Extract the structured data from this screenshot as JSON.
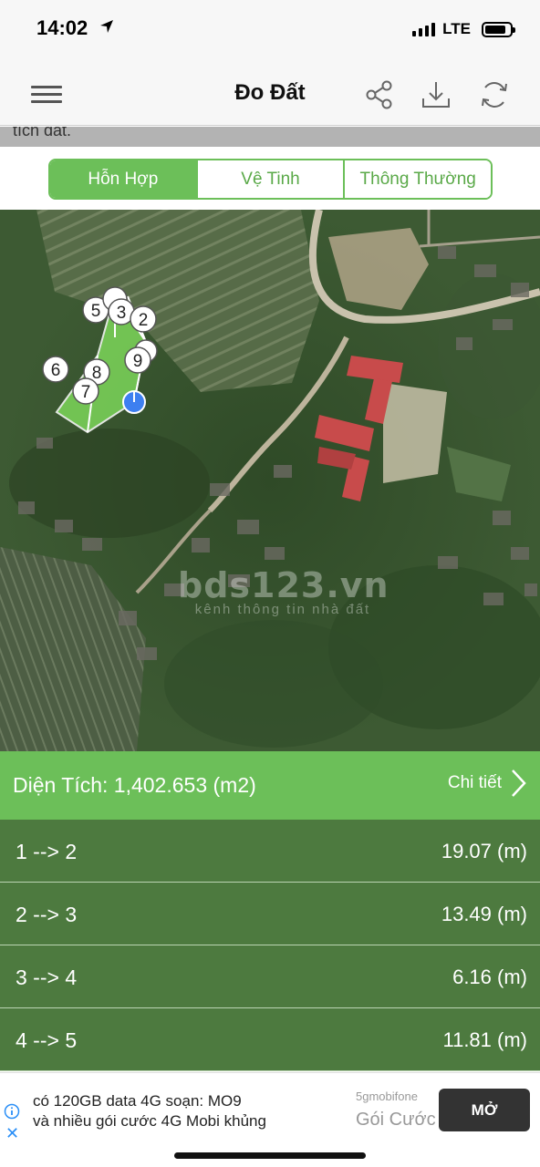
{
  "status_bar": {
    "time": "14:02",
    "network": "LTE",
    "location_icon": "location-arrow-icon",
    "signal_icon": "cellular-signal-icon",
    "battery_icon": "battery-icon"
  },
  "nav": {
    "title": "Đo Đất",
    "menu_icon": "hamburger-menu-icon",
    "share_icon": "share-icon",
    "download_icon": "download-icon",
    "refresh_icon": "refresh-icon"
  },
  "banner_clipped_text": "tích đất.",
  "map_types": {
    "options": [
      "Hỗn Hợp",
      "Vệ Tinh",
      "Thông Thường"
    ],
    "selected": "Hỗn Hợp"
  },
  "map": {
    "markers": [
      "2",
      "3",
      "5",
      "6",
      "7",
      "8",
      "9"
    ],
    "watermark": "bds123.vn",
    "watermark_sub": "kênh thông tin nhà đất",
    "polygon_fill": "#7cd65a"
  },
  "area": {
    "label": "Diện Tích: 1,402.653 (m2)",
    "detail_label": "Chi tiết",
    "detail_icon": "chevron-right-icon"
  },
  "edges": [
    {
      "label": "1 --> 2",
      "value": "19.07 (m)"
    },
    {
      "label": "2 --> 3",
      "value": "13.49 (m)"
    },
    {
      "label": "3 --> 4",
      "value": "6.16 (m)"
    },
    {
      "label": "4 --> 5",
      "value": "11.81 (m)"
    }
  ],
  "ad": {
    "line1": "có 120GB data 4G soạn: MO9",
    "line2": "và nhiều gói cước 4G Mobi khủng",
    "brand": "5gmobifone",
    "brand_main": "Gói Cước",
    "cta": "MỞ",
    "info_icon": "info-icon",
    "close_icon": "close-icon"
  },
  "colors": {
    "accent_green": "#6cbf59",
    "row_green": "#4d7a3f",
    "marker_blue": "#3d7ff0"
  }
}
